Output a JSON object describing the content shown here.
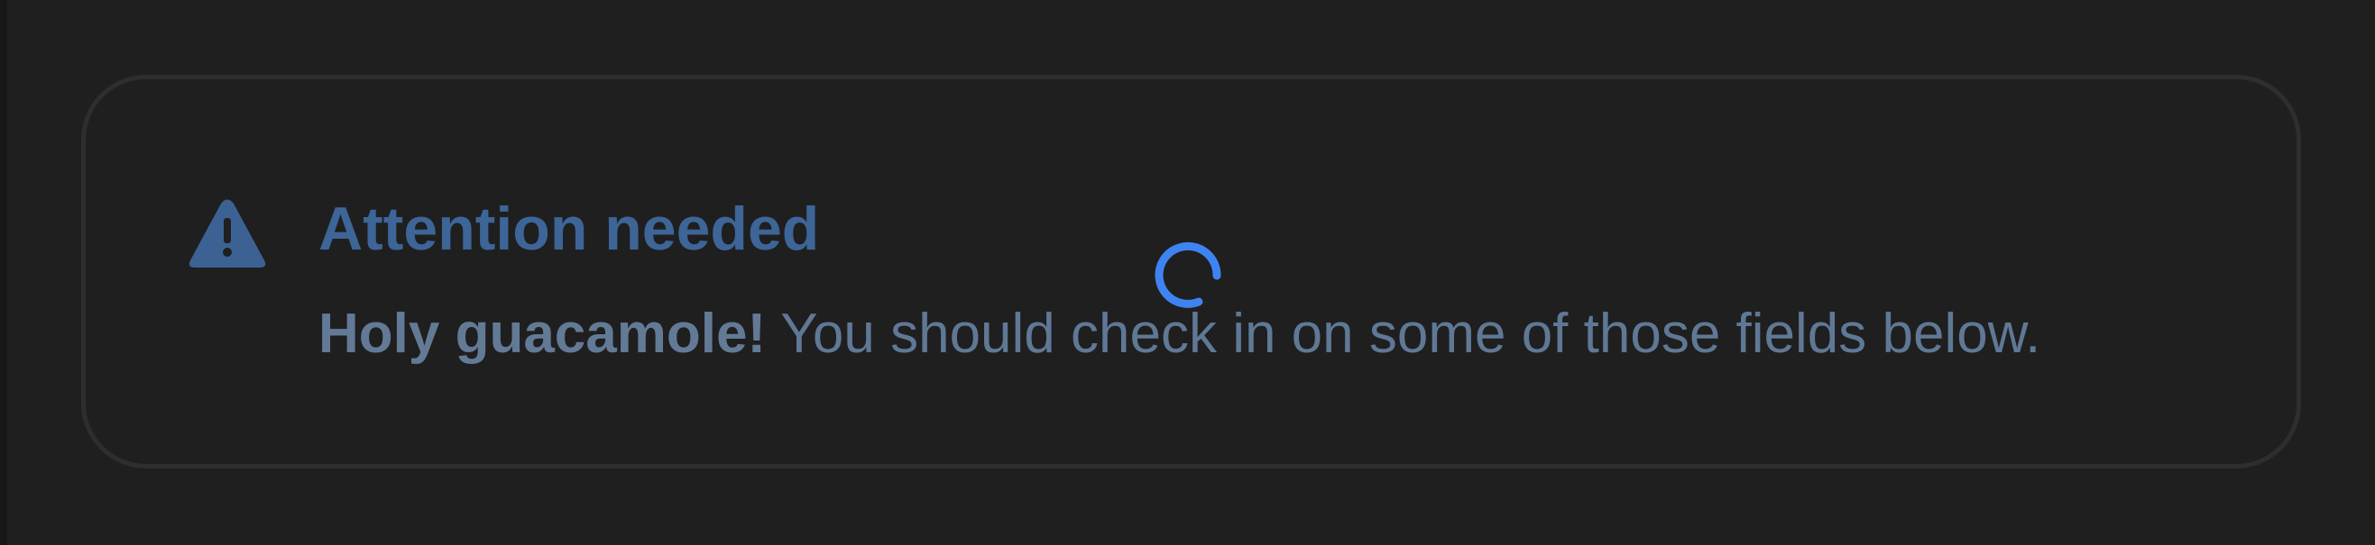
{
  "alert": {
    "title": "Attention needed",
    "emphasis": "Holy guacamole!",
    "message": " You should check in on some of those fields below.",
    "icon": "warning-triangle-icon",
    "colors": {
      "title": "#3d6597",
      "message": "#5f7895",
      "icon": "#3c6294",
      "border": "#2e2e2e",
      "background": "#1f1f1f"
    }
  },
  "loading_indicator": {
    "icon": "spinner-icon",
    "color": "#3f83f2"
  }
}
